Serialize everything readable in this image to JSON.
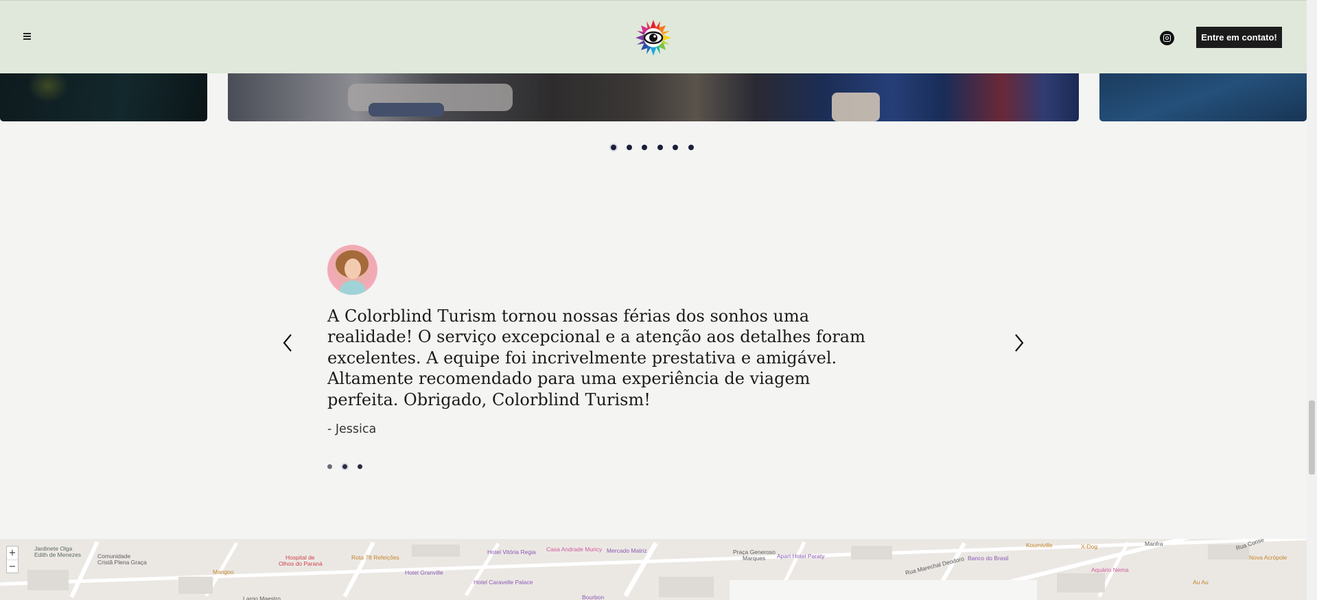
{
  "header": {
    "menu_icon": "hamburger-menu-icon",
    "logo_icon": "eye-flower-logo",
    "social_icon": "instagram-icon",
    "contact_button": "Entre em contato!"
  },
  "gallery": {
    "dot_count": 6,
    "active_dot_index": 0
  },
  "testimonial": {
    "quote": "A Colorblind Turism tornou nossas férias dos sonhos uma realidade! O serviço excepcional e a atenção aos detalhes foram excelentes. A equipe foi incrivelmente prestativa e amigável. Altamente recomendado para uma experiência de viagem perfeita. Obrigado, Colorblind Turism!",
    "author": "- Jessica",
    "dot_count": 3,
    "active_dot_index": 1,
    "prev_icon": "chevron-left-icon",
    "next_icon": "chevron-right-icon"
  },
  "map": {
    "zoom_in": "+",
    "zoom_out": "−",
    "labels": [
      {
        "text": "Jardinete Olga",
        "cls": "g"
      },
      {
        "text": "Edith de Menezes",
        "cls": "g"
      },
      {
        "text": "Comunidade",
        "cls": "s"
      },
      {
        "text": "Cristã Plena Graça",
        "cls": "s"
      },
      {
        "text": "Hospital de",
        "cls": "r"
      },
      {
        "text": "Olhos do Paraná",
        "cls": "r"
      },
      {
        "text": "Rota 78 Refeições",
        "cls": "o"
      },
      {
        "text": "Mangoo",
        "cls": "o"
      },
      {
        "text": "Hotel Granville",
        "cls": "p"
      },
      {
        "text": "Hotel Vitória Regia",
        "cls": "p"
      },
      {
        "text": "Casa Andrade Muricy",
        "cls": "pk"
      },
      {
        "text": "Mercado Matriz",
        "cls": "p"
      },
      {
        "text": "Hotel Caravelle Palace",
        "cls": "p"
      },
      {
        "text": "Praça Generoso",
        "cls": "s"
      },
      {
        "text": "Marques",
        "cls": "s"
      },
      {
        "text": "Apart Hotel Paraty",
        "cls": "p"
      },
      {
        "text": "Rua Marechal Deodoro",
        "cls": "s"
      },
      {
        "text": "Banco do Brasil",
        "cls": "p"
      },
      {
        "text": "Manfra",
        "cls": "s"
      },
      {
        "text": "Aquário Nema",
        "cls": "pk"
      },
      {
        "text": "Nova Acrópole",
        "cls": "o"
      },
      {
        "text": "Au Au",
        "cls": "o"
      },
      {
        "text": "Largo Maestro",
        "cls": "s"
      },
      {
        "text": "Bourbon",
        "cls": "p"
      },
      {
        "text": "Rua Conse",
        "cls": "s"
      },
      {
        "text": "Koumiville",
        "cls": "o"
      },
      {
        "text": "X-Dog",
        "cls": "o"
      }
    ]
  }
}
